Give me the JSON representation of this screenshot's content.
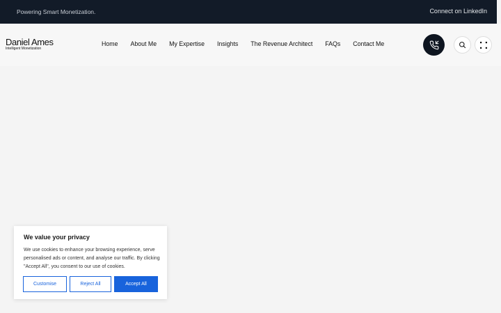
{
  "topbar": {
    "tagline": "Powering Smart Monetization.",
    "linkedin_label": "Connect on LinkedIn"
  },
  "logo": {
    "name": "Daniel Ames",
    "subtitle": "Intelligent Monetization"
  },
  "nav": {
    "items": [
      "Home",
      "About Me",
      "My Expertise",
      "Insights",
      "The Revenue Architect",
      "FAQs",
      "Contact Me"
    ]
  },
  "header_actions": {
    "call_icon": "phone-incoming-icon",
    "search_icon": "search-icon",
    "menu_icon": "grid-dots-icon"
  },
  "cookie_banner": {
    "title": "We value your privacy",
    "text": "We use cookies to enhance your browsing experience, serve personalised ads or content, and analyse our traffic. By clicking \"Accept All\", you consent to our use of cookies.",
    "customise_label": "Customise",
    "reject_label": "Reject All",
    "accept_label": "Accept All"
  },
  "colors": {
    "topbar_bg": "#121b28",
    "accent_blue": "#1863dc",
    "call_button_bg": "#0e1520"
  }
}
